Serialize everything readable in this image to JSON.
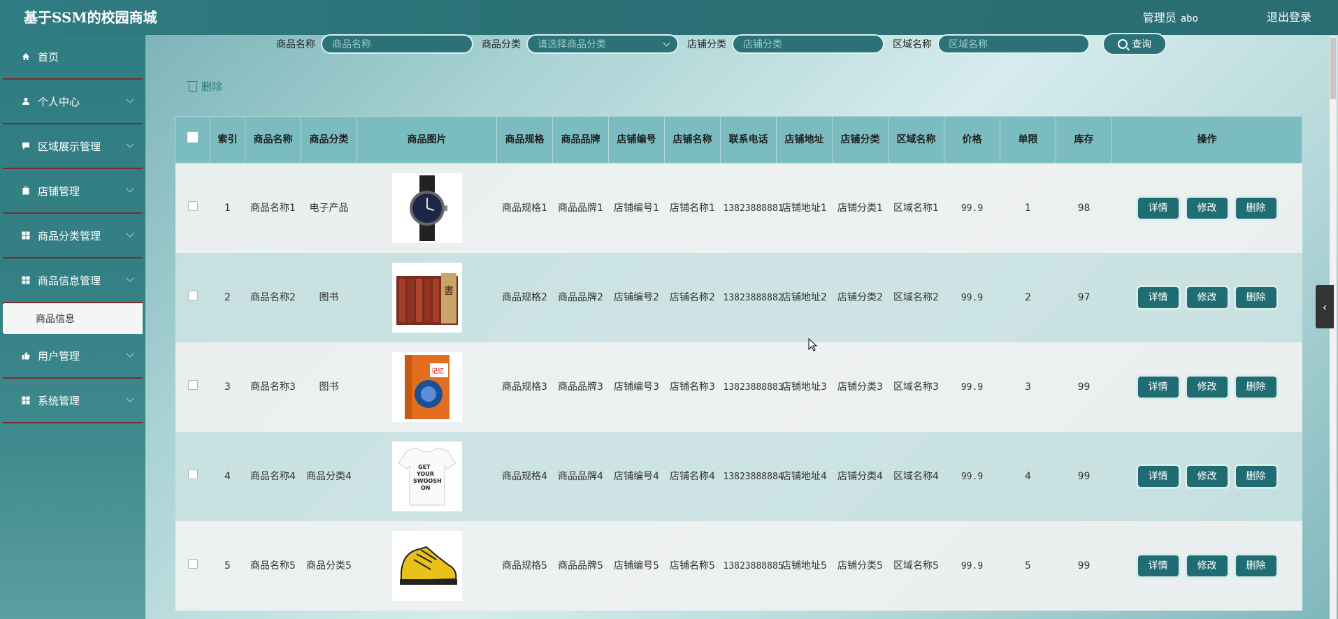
{
  "header": {
    "title": "基于SSM的校园商城",
    "role": "管理员",
    "username": "abo",
    "logout": "退出登录"
  },
  "sidebar": {
    "items": [
      {
        "label": "首页",
        "icon": "home-icon"
      },
      {
        "label": "个人中心",
        "icon": "user-icon"
      },
      {
        "label": "区域展示管理",
        "icon": "chat-icon"
      },
      {
        "label": "店铺管理",
        "icon": "store-icon"
      },
      {
        "label": "商品分类管理",
        "icon": "grid-icon"
      },
      {
        "label": "商品信息管理",
        "icon": "grid-icon"
      },
      {
        "label": "用户管理",
        "icon": "thumb-icon"
      },
      {
        "label": "系统管理",
        "icon": "grid-icon"
      }
    ],
    "active_sub": "商品信息"
  },
  "search": {
    "name_label": "商品名称",
    "name_placeholder": "商品名称",
    "category_label": "商品分类",
    "category_placeholder": "请选择商品分类",
    "shopcat_label": "店铺分类",
    "shopcat_placeholder": "店铺分类",
    "area_label": "区域名称",
    "area_placeholder": "区域名称",
    "query_button": "查询"
  },
  "toolbar": {
    "delete_label": "删除"
  },
  "table": {
    "headers": {
      "index": "索引",
      "name": "商品名称",
      "category": "商品分类",
      "image": "商品图片",
      "spec": "商品规格",
      "brand": "商品品牌",
      "shop_no": "店铺编号",
      "shop_name": "店铺名称",
      "phone": "联系电话",
      "address": "店铺地址",
      "shop_cat": "店铺分类",
      "area": "区域名称",
      "price": "价格",
      "limit": "单限",
      "stock": "库存",
      "ops": "操作"
    },
    "actions": {
      "detail": "详情",
      "edit": "修改",
      "delete": "删除"
    },
    "rows": [
      {
        "index": "1",
        "name": "商品名称1",
        "category": "电子产品",
        "image": "watch",
        "spec": "商品规格1",
        "brand": "商品品牌1",
        "shop_no": "店铺编号1",
        "shop_name": "店铺名称1",
        "phone": "13823888881",
        "address": "店铺地址1",
        "shop_cat": "店铺分类1",
        "area": "区域名称1",
        "price": "99.9",
        "limit": "1",
        "stock": "98"
      },
      {
        "index": "2",
        "name": "商品名称2",
        "category": "图书",
        "image": "book-set",
        "spec": "商品规格2",
        "brand": "商品品牌2",
        "shop_no": "店铺编号2",
        "shop_name": "店铺名称2",
        "phone": "13823888882",
        "address": "店铺地址2",
        "shop_cat": "店铺分类2",
        "area": "区域名称2",
        "price": "99.9",
        "limit": "2",
        "stock": "97"
      },
      {
        "index": "3",
        "name": "商品名称3",
        "category": "图书",
        "image": "book",
        "spec": "商品规格3",
        "brand": "商品品牌3",
        "shop_no": "店铺编号3",
        "shop_name": "店铺名称3",
        "phone": "13823888883",
        "address": "店铺地址3",
        "shop_cat": "店铺分类3",
        "area": "区域名称3",
        "price": "99.9",
        "limit": "3",
        "stock": "99"
      },
      {
        "index": "4",
        "name": "商品名称4",
        "category": "商品分类4",
        "image": "tshirt",
        "spec": "商品规格4",
        "brand": "商品品牌4",
        "shop_no": "店铺编号4",
        "shop_name": "店铺名称4",
        "phone": "13823888884",
        "address": "店铺地址4",
        "shop_cat": "店铺分类4",
        "area": "区域名称4",
        "price": "99.9",
        "limit": "4",
        "stock": "99"
      },
      {
        "index": "5",
        "name": "商品名称5",
        "category": "商品分类5",
        "image": "sneaker",
        "spec": "商品规格5",
        "brand": "商品品牌5",
        "shop_no": "店铺编号5",
        "shop_name": "店铺名称5",
        "phone": "13823888885",
        "address": "店铺地址5",
        "shop_cat": "店铺分类5",
        "area": "区域名称5",
        "price": "99.9",
        "limit": "5",
        "stock": "99"
      }
    ]
  },
  "colors": {
    "primary": "#2a7277",
    "header_row": "#7bbcc0",
    "button": "#1f6d72"
  }
}
